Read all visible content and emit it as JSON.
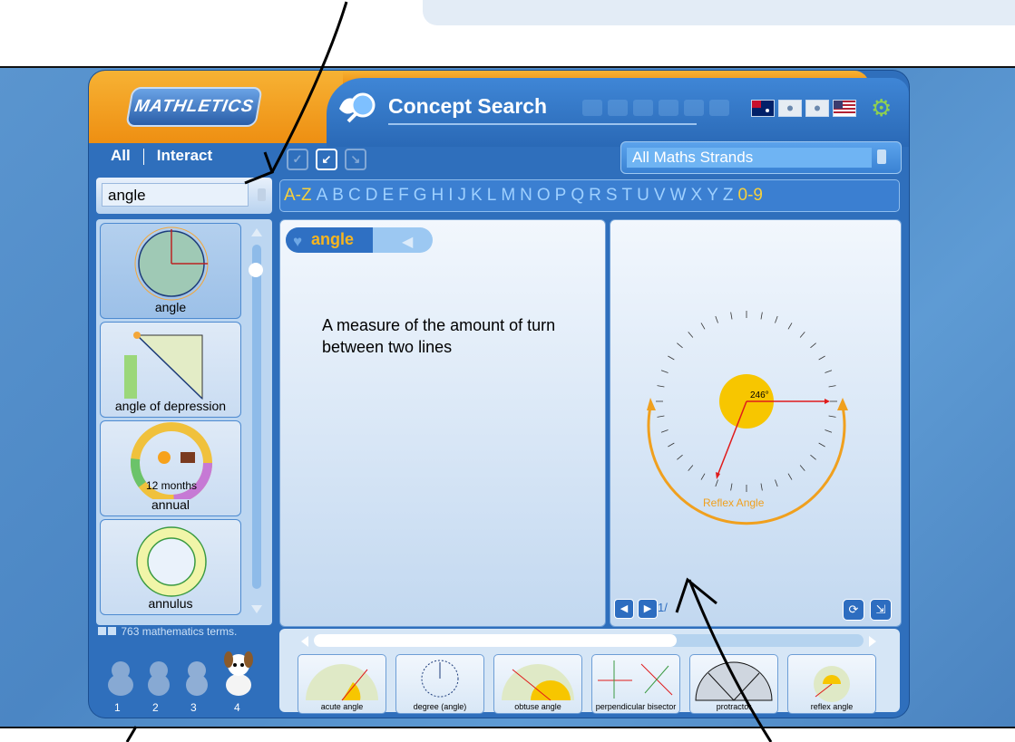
{
  "header": {
    "logo": "MATHLETICS",
    "title": "Concept Search"
  },
  "tabs": {
    "all": "All",
    "interact": "Interact"
  },
  "strand": {
    "selected": "All Maths Strands"
  },
  "search": {
    "value": "angle"
  },
  "alphabet": [
    "A-Z",
    "A",
    "B",
    "C",
    "D",
    "E",
    "F",
    "G",
    "H",
    "I",
    "J",
    "K",
    "L",
    "M",
    "N",
    "O",
    "P",
    "Q",
    "R",
    "S",
    "T",
    "U",
    "V",
    "W",
    "X",
    "Y",
    "Z",
    "0-9"
  ],
  "terms": [
    {
      "label": "angle"
    },
    {
      "label": "angle of depression"
    },
    {
      "label": "annual",
      "inner_text": "12 months"
    },
    {
      "label": "annulus"
    }
  ],
  "term_count": "763 mathematics terms.",
  "levels": [
    "1",
    "2",
    "3",
    "4"
  ],
  "definition": {
    "word": "angle",
    "text": "A measure of the amount of turn between two lines"
  },
  "illustration": {
    "angle_label": "246°",
    "caption": "Reflex Angle",
    "page": "1/"
  },
  "related": [
    {
      "label": "acute angle"
    },
    {
      "label": "degree (angle)"
    },
    {
      "label": "obtuse angle"
    },
    {
      "label": "perpendicular bisector"
    },
    {
      "label": "protractor"
    },
    {
      "label": "reflex angle"
    }
  ],
  "colors": {
    "accent": "#f7b51f",
    "frame": "#2f6fbc",
    "orange": "#ee8f12"
  }
}
